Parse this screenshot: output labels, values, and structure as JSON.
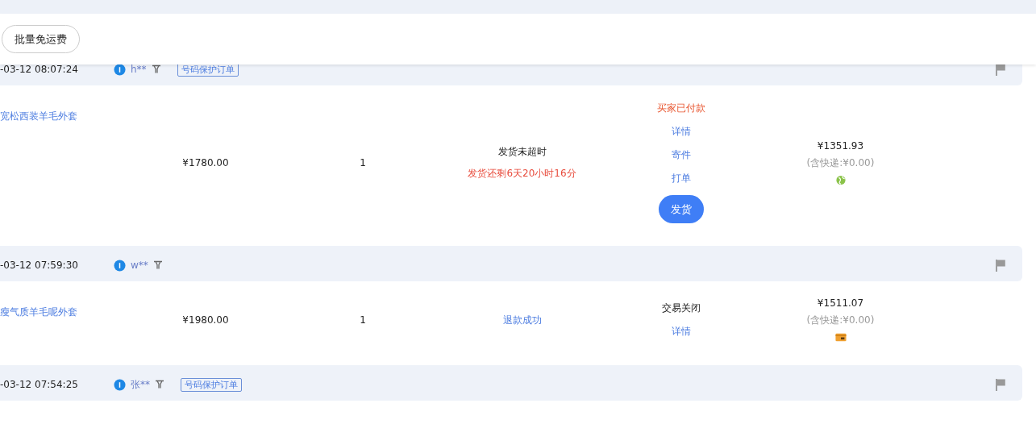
{
  "toolbar": {
    "buttons": [
      {
        "label": "批量免运费"
      }
    ]
  },
  "orders": [
    {
      "time": "-03-12 08:07:24",
      "buyer": "h**",
      "tag": "号码保护订单",
      "product": "宽松西装羊毛外套",
      "price": "¥1780.00",
      "quantity": "1",
      "shipping": [
        {
          "kind": "plain",
          "text": "发货未超时"
        },
        {
          "kind": "warning",
          "text": "发货还剩6天20小时16分"
        }
      ],
      "actions": [
        {
          "kind": "status",
          "text": "买家已付款"
        },
        {
          "kind": "link",
          "text": "详情"
        },
        {
          "kind": "link",
          "text": "寄件"
        },
        {
          "kind": "link",
          "text": "打单"
        },
        {
          "kind": "button",
          "text": "发货"
        }
      ],
      "total": "¥1351.93",
      "shipping_fee": "(含快递:¥0.00)",
      "payment": {
        "kind": "globe"
      }
    },
    {
      "time": "-03-12 07:59:30",
      "buyer": "w**",
      "product": "瘦气质羊毛呢外套",
      "price": "¥1980.00",
      "quantity": "1",
      "shipping": [
        {
          "kind": "link",
          "text": "退款成功"
        }
      ],
      "actions": [
        {
          "kind": "plain",
          "text": "交易关闭"
        },
        {
          "kind": "link",
          "text": "详情"
        }
      ],
      "total": "¥1511.07",
      "shipping_fee": "(含快递:¥0.00)",
      "payment": {
        "kind": "wallet"
      }
    },
    {
      "time": "-03-12 07:54:25",
      "buyer": "张**",
      "tag": "号码保护订单"
    }
  ]
}
